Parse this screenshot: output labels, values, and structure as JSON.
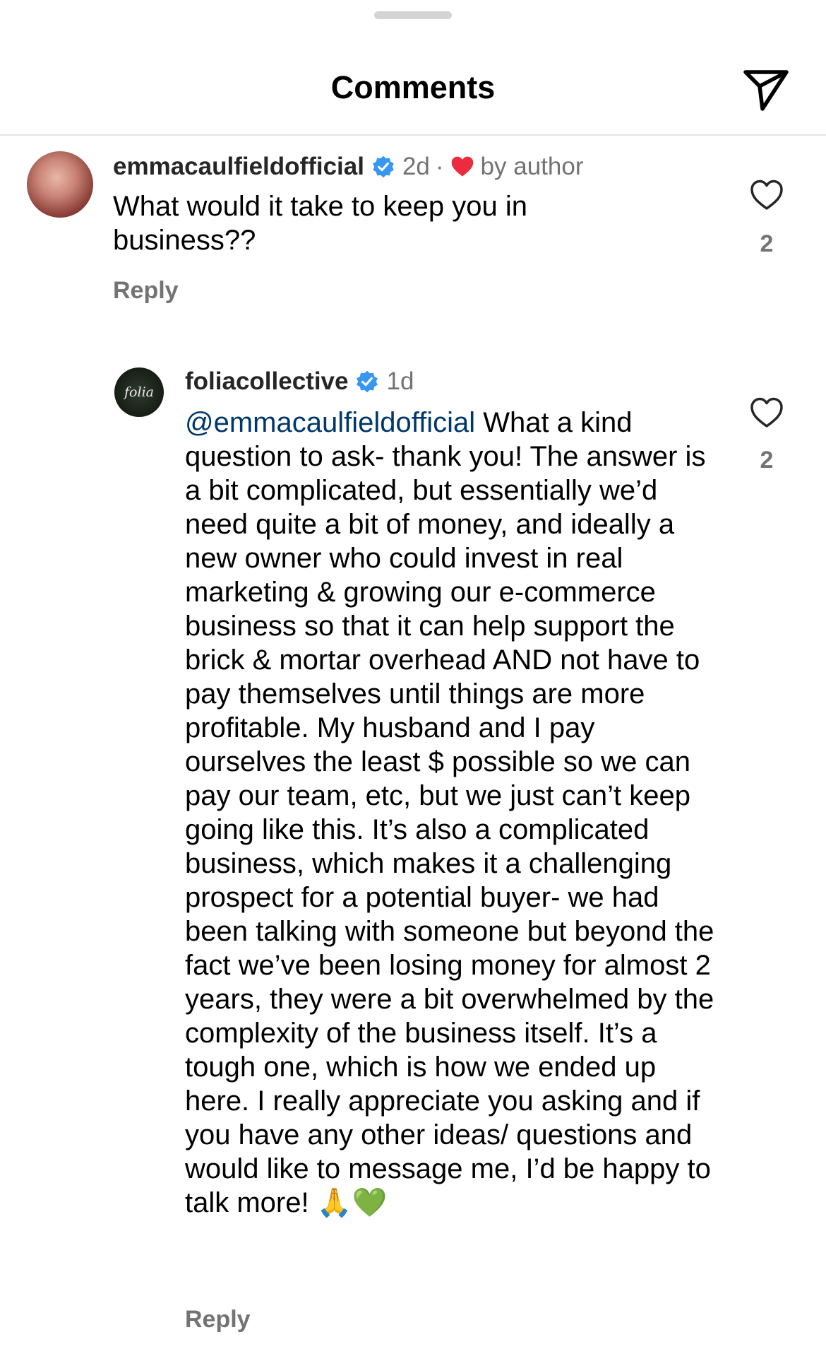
{
  "header": {
    "title": "Comments",
    "send_icon": "paper-plane-icon"
  },
  "comments": [
    {
      "username": "emmacaulfieldofficial",
      "verified": true,
      "time": "2d",
      "separator": "·",
      "liked_by_author": "by author",
      "text": "What would it take to keep you in business??",
      "reply_label": "Reply",
      "like_count": "2"
    },
    {
      "username": "foliacollective",
      "verified": true,
      "time": "1d",
      "avatar_text": "folia",
      "mention": "@emmacaulfieldofficial",
      "text": " What a kind question to ask- thank you! The answer is a bit complicated, but essentially we’d need quite a bit of money, and ideally a new owner who could invest in real marketing & growing our e-commerce business so that it can help support the brick & mortar overhead AND not have to pay themselves until things are more profitable. My husband and I pay ourselves the least $ possible so we can pay our team, etc, but we just can’t keep going like this. It’s also a complicated business, which makes it a challenging prospect for a potential buyer- we had been talking with someone but beyond the fact we’ve been losing money for almost 2 years, they were a bit overwhelmed by the complexity of the business itself. It’s a tough one, which is how we ended up here. I really appreciate you asking and if you have any other ideas/ questions and would like to message me, I’d be happy to talk more! ",
      "emojis": "🙏💚",
      "reply_label": "Reply",
      "like_count": "2"
    }
  ],
  "colors": {
    "verified": "#3897f0",
    "heart_red": "#ed2b3e",
    "mention": "#00376b",
    "secondary_text": "#737373"
  }
}
